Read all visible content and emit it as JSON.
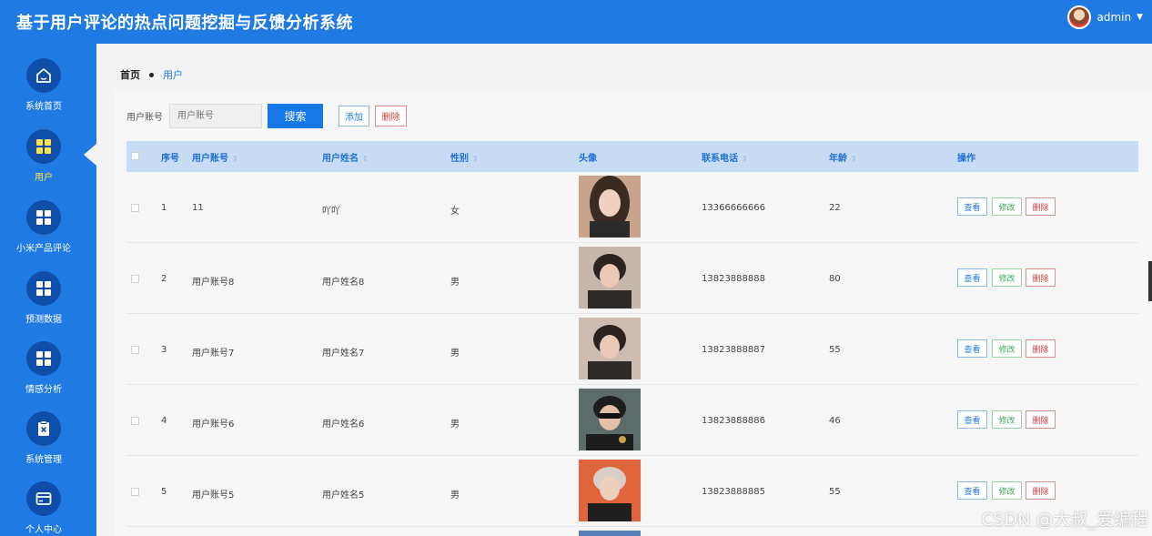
{
  "header": {
    "title": "基于用户评论的热点问题挖掘与反馈分析系统",
    "username": "admin"
  },
  "sidebar": {
    "items": [
      {
        "label": "系统首页",
        "icon": "home-icon"
      },
      {
        "label": "用户",
        "icon": "grid-icon",
        "active": true
      },
      {
        "label": "小米产品评论",
        "icon": "grid-icon"
      },
      {
        "label": "预测数据",
        "icon": "grid-icon"
      },
      {
        "label": "情感分析",
        "icon": "grid-icon"
      },
      {
        "label": "系统管理",
        "icon": "clipboard-x-icon"
      },
      {
        "label": "个人中心",
        "icon": "card-icon"
      }
    ]
  },
  "breadcrumb": {
    "home": "首页",
    "current": "用户"
  },
  "search": {
    "label": "用户账号",
    "placeholder": "用户账号",
    "search_button": "搜索",
    "add_button": "添加",
    "delete_button": "删除"
  },
  "table": {
    "columns": {
      "index": "序号",
      "account": "用户账号",
      "name": "用户姓名",
      "gender": "性别",
      "avatar": "头像",
      "phone": "联系电话",
      "age": "年龄",
      "actions": "操作"
    },
    "actions": {
      "view": "查看",
      "edit": "修改",
      "delete": "删除"
    },
    "rows": [
      {
        "index": "1",
        "account": "11",
        "name": "吖吖",
        "gender": "女",
        "phone": "13366666666",
        "age": "22"
      },
      {
        "index": "2",
        "account": "用户账号8",
        "name": "用户姓名8",
        "gender": "男",
        "phone": "13823888888",
        "age": "80"
      },
      {
        "index": "3",
        "account": "用户账号7",
        "name": "用户姓名7",
        "gender": "男",
        "phone": "13823888887",
        "age": "55"
      },
      {
        "index": "4",
        "account": "用户账号6",
        "name": "用户姓名6",
        "gender": "男",
        "phone": "13823888886",
        "age": "46"
      },
      {
        "index": "5",
        "account": "用户账号5",
        "name": "用户姓名5",
        "gender": "男",
        "phone": "13823888885",
        "age": "55"
      }
    ]
  },
  "watermark": "CSDN @大叔_爱编程",
  "colors": {
    "primary": "#1f7be3",
    "sidebar_circle": "#0f4ea8",
    "active_label": "#ffe24a",
    "table_header": "#c9dcf6"
  }
}
